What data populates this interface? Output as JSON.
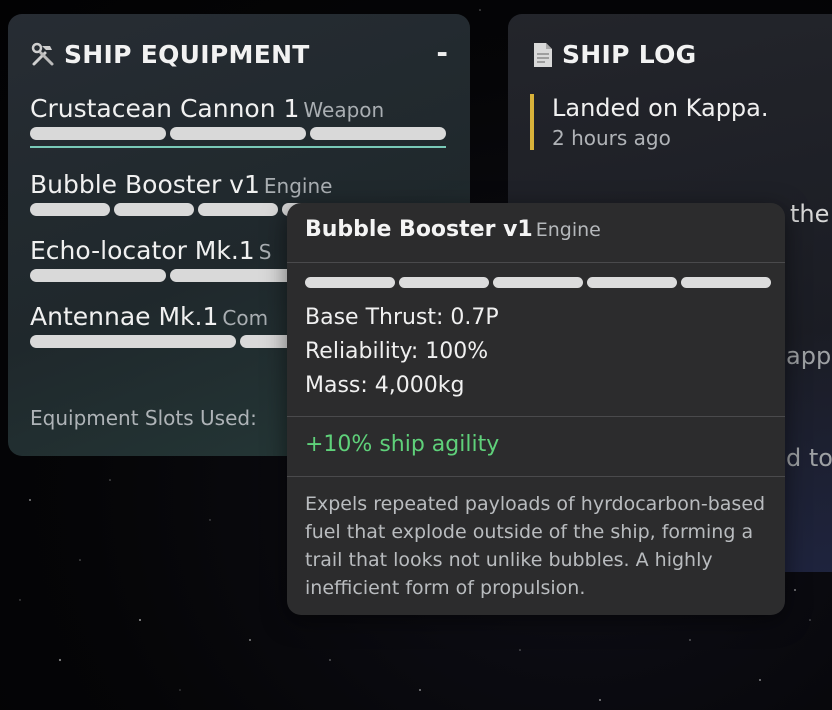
{
  "equipment": {
    "title": "SHIP EQUIPMENT",
    "minimize_label": "-",
    "items": [
      {
        "name": "Crustacean Cannon 1",
        "type": "Weapon"
      },
      {
        "name": "Bubble Booster v1",
        "type": "Engine"
      },
      {
        "name": "Echo-locator Mk.1",
        "type": "S"
      },
      {
        "name": "Antennae Mk.1",
        "type": "Com"
      }
    ],
    "slots_label": "Equipment Slots Used:"
  },
  "log": {
    "title": "SHIP LOG",
    "entries": [
      {
        "text": "Landed on Kappa.",
        "time": "2 hours ago"
      }
    ],
    "ghost_lines": [
      "the",
      "appa",
      "d tov"
    ]
  },
  "tooltip": {
    "name": "Bubble Booster v1",
    "type": "Engine",
    "stats": [
      "Base Thrust: 0.7P",
      "Reliability: 100%",
      "Mass: 4,000kg"
    ],
    "bonus": "+10% ship agility",
    "description": "Expels repeated payloads of hyrdocarbon-based fuel that explode outside of the ship, forming a trail that looks not unlike bubbles. A highly inefficient form of propulsion."
  },
  "colors": {
    "accent_teal": "#79c9b8",
    "log_marker": "#d8b23a",
    "bonus_green": "#5fd17a"
  },
  "icons": {
    "equipment": "tools-icon",
    "log": "document-icon"
  }
}
